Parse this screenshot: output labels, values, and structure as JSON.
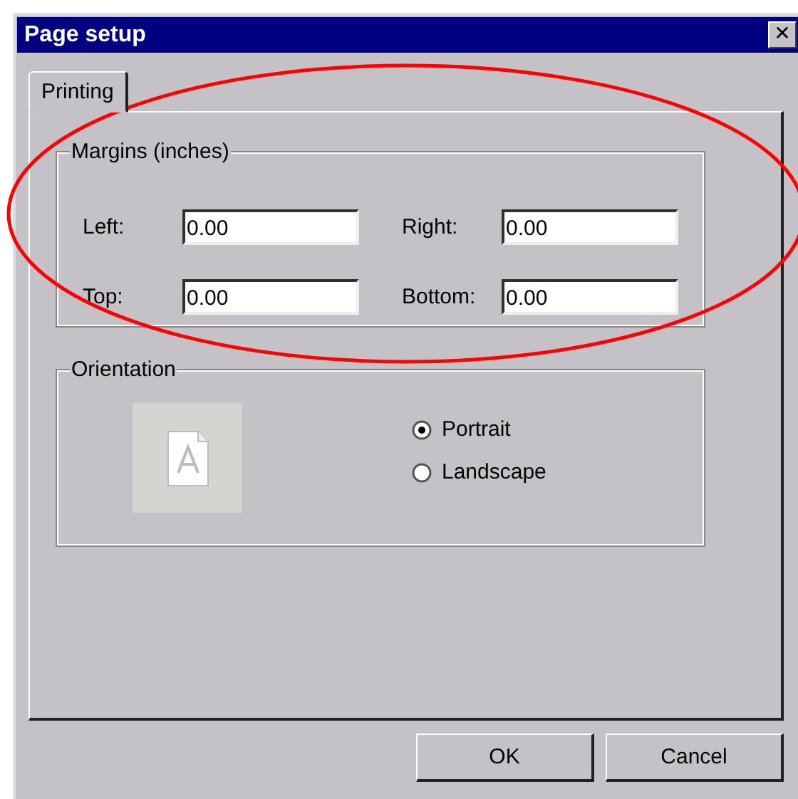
{
  "window": {
    "title": "Page setup",
    "close": "✕"
  },
  "tabs": [
    {
      "label": "Printing",
      "selected": true
    }
  ],
  "margins": {
    "title": "Margins (inches)",
    "fields": [
      {
        "label": "Left:",
        "value": "0.00"
      },
      {
        "label": "Right:",
        "value": "0.00"
      },
      {
        "label": "Top:",
        "value": "0.00"
      },
      {
        "label": "Bottom:",
        "value": "0.00"
      }
    ]
  },
  "orientation": {
    "title": "Orientation",
    "options": [
      {
        "label": "Portrait",
        "selected": true
      },
      {
        "label": "Landscape",
        "selected": false
      }
    ]
  },
  "buttons": [
    "OK",
    "Cancel"
  ],
  "annotation": {
    "kind": "ellipse"
  }
}
